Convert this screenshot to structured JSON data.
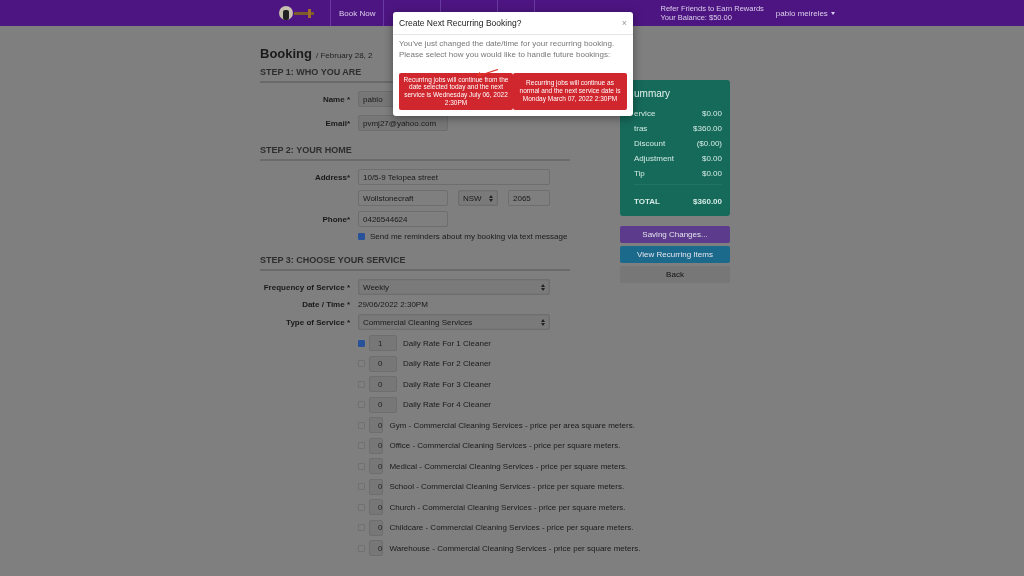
{
  "nav": {
    "links": [
      "Book Now"
    ],
    "rewards": {
      "line1": "Refer Friends to Earn Rewards",
      "line2": "Your Balance: $50.00"
    },
    "user": "pablo meireles"
  },
  "page": {
    "title": "Booking",
    "subtitle": "/ February 28, 2"
  },
  "step1": {
    "heading": "STEP 1: WHO YOU ARE",
    "fields": [
      {
        "label": "Name *",
        "value": "pablo"
      },
      {
        "label": "Email*",
        "value": "pvmj27@yahoo.com"
      }
    ]
  },
  "step2": {
    "heading": "STEP 2: YOUR HOME",
    "address_label": "Address*",
    "address": "10/5-9 Telopea street",
    "city": "Wollstonecraft",
    "state": "NSW",
    "postcode": "2065",
    "phone_label": "Phone*",
    "phone": "0426544624",
    "sms": {
      "checked": true,
      "label": "Send me reminders about my booking via text message"
    }
  },
  "step3": {
    "heading": "STEP 3: CHOOSE YOUR SERVICE",
    "frequency_label": "Frequency of Service *",
    "frequency": "Weekly",
    "date_label": "Date / Time *",
    "date": "29/06/2022 2:30PM",
    "type_label": "Type of Service *",
    "type": "Commercial Cleaning Services",
    "items": [
      {
        "checked": true,
        "qty": "1",
        "label": "Daily Rate For 1 Cleaner"
      },
      {
        "checked": false,
        "qty": "0",
        "label": "Daily Rate For 2 Cleaner"
      },
      {
        "checked": false,
        "qty": "0",
        "label": "Daily Rate For 3 Cleaner"
      },
      {
        "checked": false,
        "qty": "0",
        "label": "Daily Rate For 4 Cleaner"
      },
      {
        "checked": false,
        "qty": "0",
        "label": "Gym - Commercial Cleaning Services - price per area square meters."
      },
      {
        "checked": false,
        "qty": "0",
        "label": "Office - Commercial Cleaning Services - price per square meters."
      },
      {
        "checked": false,
        "qty": "0",
        "label": "Medical - Commercial Cleaning Services - price per square meters."
      },
      {
        "checked": false,
        "qty": "0",
        "label": "School - Commercial Cleaning Services - price per square meters."
      },
      {
        "checked": false,
        "qty": "0",
        "label": "Church - Commercial Cleaning Services - price per square meters."
      },
      {
        "checked": false,
        "qty": "0",
        "label": "Childcare - Commercial Cleaning Services - price per square meters."
      },
      {
        "checked": false,
        "qty": "0",
        "label": "Warehouse - Commercial Cleaning Services - price per square meters."
      }
    ]
  },
  "summary": {
    "title": "ummary",
    "rows": [
      {
        "label": "ervice",
        "value": "$0.00"
      },
      {
        "label": "tras",
        "value": "$360.00"
      },
      {
        "label": "Discount",
        "value": "($0.00)"
      },
      {
        "label": "Adjustment",
        "value": "$0.00"
      },
      {
        "label": "Tip",
        "value": "$0.00"
      }
    ],
    "total_label": "TOTAL",
    "total": "$360.00"
  },
  "actions": [
    {
      "kind": "saving",
      "label": "Saving Changes..."
    },
    {
      "kind": "info",
      "label": "View Recurring Items"
    },
    {
      "kind": "back",
      "label": "Back"
    }
  ],
  "modal": {
    "title": "Create Next Recurring Booking?",
    "close": "×",
    "message": "You've just changed the date/time for your recurring booking. Please select how you would like to handle future bookings:",
    "options": [
      "Recurring jobs will continue from the date selected today and the next service is Wednesday July 06, 2022 2:30PM",
      "Recurring jobs will continue as normal and the next service date is Monday March 07, 2022 2:30PM"
    ]
  }
}
